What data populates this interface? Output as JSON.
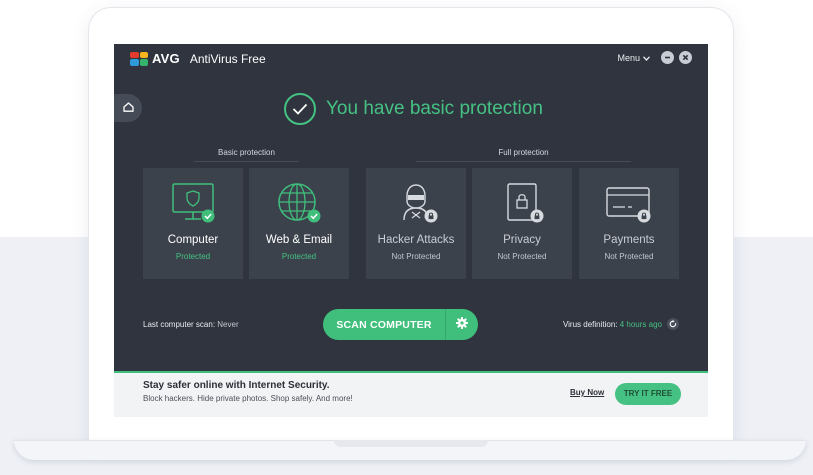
{
  "app": {
    "brand": "AVG",
    "product": "AntiVirus Free",
    "menu_label": "Menu",
    "logo_colors": [
      "#e53b2c",
      "#f7b51b",
      "#2e9ad8",
      "#36b46b"
    ]
  },
  "status": {
    "message": "You have basic protection",
    "color": "#45c283"
  },
  "sections": {
    "basic_label": "Basic protection",
    "full_label": "Full protection"
  },
  "cards": [
    {
      "name": "Computer",
      "state": "Protected",
      "icon": "monitor-shield-icon"
    },
    {
      "name": "Web & Email",
      "state": "Protected",
      "icon": "globe-icon"
    },
    {
      "name": "Hacker Attacks",
      "state": "Not Protected",
      "icon": "hacker-icon"
    },
    {
      "name": "Privacy",
      "state": "Not Protected",
      "icon": "privacy-lock-icon"
    },
    {
      "name": "Payments",
      "state": "Not Protected",
      "icon": "credit-card-icon"
    }
  ],
  "scan": {
    "last_scan_label": "Last computer scan:",
    "last_scan_value": "Never",
    "button_label": "SCAN COMPUTER",
    "virus_def_label": "Virus definition:",
    "virus_def_value": "4 hours ago"
  },
  "promo": {
    "title": "Stay safer online with Internet Security.",
    "subtitle": "Block hackers. Hide private photos. Shop safely. And more!",
    "buy_now": "Buy Now",
    "try_free": "TRY IT FREE"
  },
  "colors": {
    "accent": "#3fbf7b",
    "background": "#2f343e",
    "card": "#3c424c"
  }
}
